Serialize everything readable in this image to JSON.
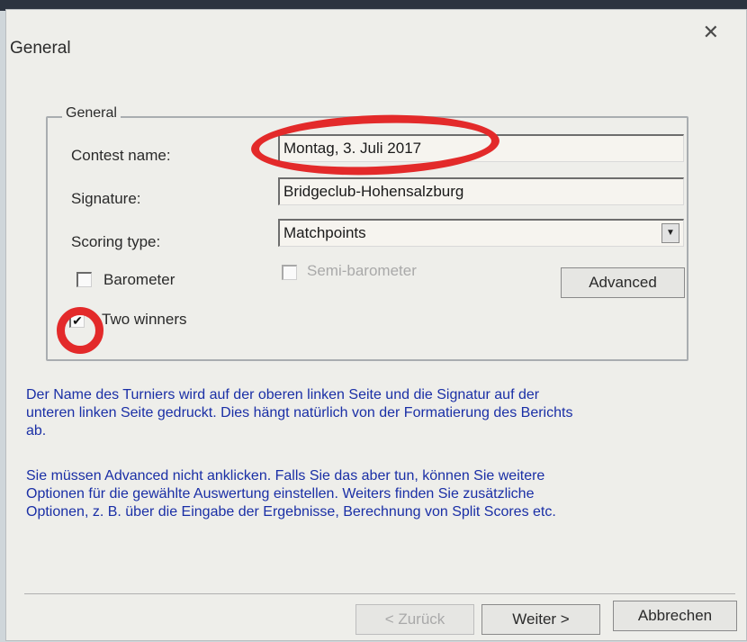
{
  "window": {
    "title": "General",
    "close_glyph": "✕"
  },
  "general_group": {
    "label": "General",
    "contest_name": {
      "label": "Contest name:",
      "value": "Montag, 3. Juli 2017"
    },
    "signature": {
      "label": "Signature:",
      "value": "Bridgeclub-Hohensalzburg"
    },
    "scoring_type": {
      "label": "Scoring type:",
      "value": "Matchpoints"
    },
    "barometer": {
      "label": "Barometer",
      "checked": false
    },
    "semi_barometer": {
      "label": "Semi-barometer",
      "checked": false,
      "enabled": false
    },
    "advanced_label": "Advanced",
    "two_winners": {
      "label": "Two winners",
      "checked": true,
      "check_glyph": "✔"
    }
  },
  "help": {
    "paragraph_1": [
      "Der Name des Turniers wird auf der oberen linken Seite und die Signatur auf der",
      "unteren linken Seite gedruckt. Dies hängt natürlich von der Formatierung des Berichts",
      "ab."
    ],
    "paragraph_2": [
      "Sie müssen Advanced nicht anklicken. Falls Sie das aber tun, können Sie weitere",
      "Optionen für die gewählte Auswertung einstellen. Weiters finden Sie zusätzliche",
      "Optionen, z. B. über die Eingabe der Ergebnisse, Berechnung von Split Scores etc."
    ],
    "color": "#1a2fa6"
  },
  "footer": {
    "back_label": "< Zurück",
    "next_label": "Weiter >",
    "cancel_label": "Abbrechen"
  },
  "annotations": {
    "color": "#e32a2a"
  }
}
